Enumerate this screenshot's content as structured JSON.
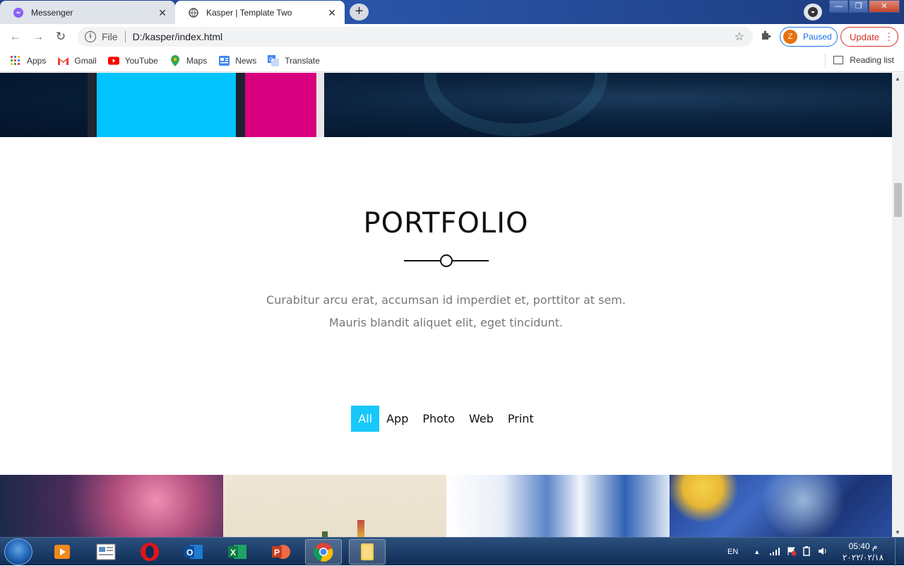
{
  "browser": {
    "tabs": [
      {
        "title": "Messenger",
        "icon": "messenger-icon",
        "active": false
      },
      {
        "title": "Kasper | Template Two",
        "icon": "globe-icon",
        "active": true
      }
    ],
    "address": {
      "scheme_label": "File",
      "url": "D:/kasper/index.html"
    },
    "profile": {
      "initial": "Z",
      "status": "Paused"
    },
    "update_label": "Update",
    "bookmarks": [
      {
        "label": "Apps",
        "icon": "apps-grid-icon"
      },
      {
        "label": "Gmail",
        "icon": "gmail-icon"
      },
      {
        "label": "YouTube",
        "icon": "youtube-icon"
      },
      {
        "label": "Maps",
        "icon": "maps-pin-icon"
      },
      {
        "label": "News",
        "icon": "news-icon"
      },
      {
        "label": "Translate",
        "icon": "translate-icon"
      }
    ],
    "reading_list": "Reading list"
  },
  "page": {
    "section_title": "PORTFOLIO",
    "description": "Curabitur arcu erat, accumsan id imperdiet et, porttitor at sem. Mauris blandit aliquet elit, eget tincidunt.",
    "filters": [
      {
        "label": "All",
        "active": true
      },
      {
        "label": "App",
        "active": false
      },
      {
        "label": "Photo",
        "active": false
      },
      {
        "label": "Web",
        "active": false
      },
      {
        "label": "Print",
        "active": false
      }
    ],
    "accent_color": "#19c8fa"
  },
  "taskbar": {
    "language": "EN",
    "time": "05:40 م",
    "date": "٢٠٢٢/٠٢/١٨"
  }
}
